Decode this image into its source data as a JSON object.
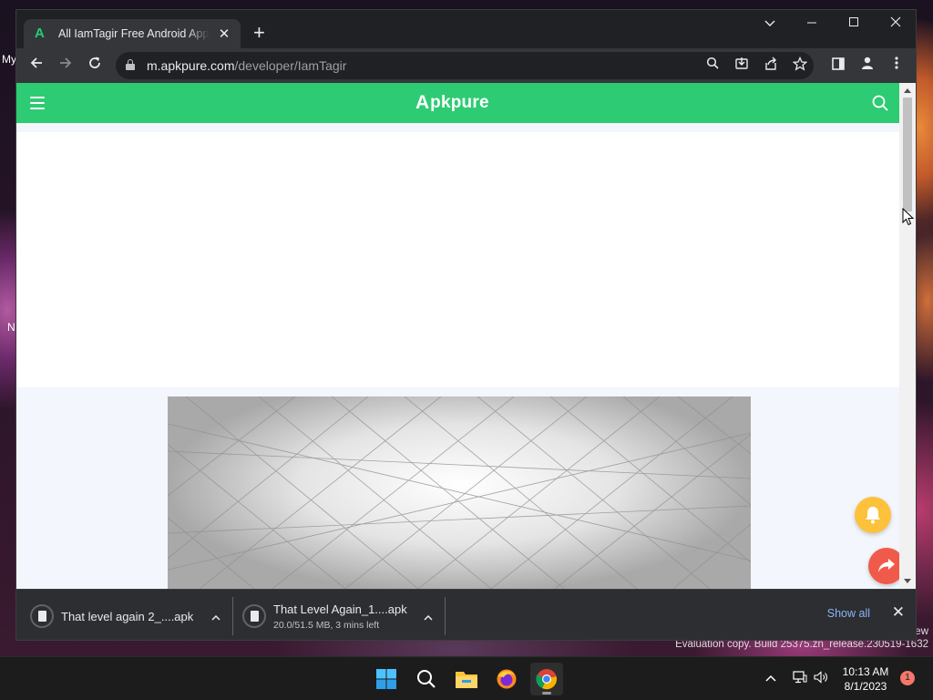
{
  "desktop": {
    "icon_labels": [
      "My",
      "N"
    ],
    "watermark_line1": "ew",
    "watermark_line2": "Evaluation copy. Build 25375.zn_release.230519-1632"
  },
  "browser": {
    "tab": {
      "title": "All IamTagir Free Android Apps & Games",
      "favicon": "apkpure-logo-icon",
      "close": "✕"
    },
    "new_tab": "+",
    "window_controls": {
      "dropdown": "⌵",
      "minimize": "—",
      "maximize": "☐",
      "close": "✕"
    },
    "nav": {
      "back": "←",
      "forward": "→",
      "reload": "↻"
    },
    "address": {
      "host": "m.apkpure.com",
      "path": "/developer/IamTagir"
    },
    "omnibox_icons": [
      "search-icon",
      "install-app-icon",
      "share-icon",
      "bookmark-star-icon"
    ],
    "toolbar_icons": [
      "side-panel-icon",
      "profile-icon",
      "menu-kebab-icon"
    ]
  },
  "page": {
    "header": {
      "logo_mark": "A",
      "logo_text": "pkpure",
      "brand_color": "#2dcb73"
    },
    "fab_colors": {
      "notification": "#fdc13b",
      "share": "#f05a4a"
    }
  },
  "downloads": {
    "items": [
      {
        "name": "That level again 2_....apk",
        "status": ""
      },
      {
        "name": "That Level Again_1....apk",
        "status": "20.0/51.5 MB, 3 mins left"
      }
    ],
    "show_all": "Show all",
    "close": "✕"
  },
  "taskbar": {
    "apps": [
      "windows-start-icon",
      "search-icon",
      "file-explorer-icon",
      "firefox-icon",
      "chrome-icon"
    ],
    "tray_chevron": "^",
    "time": "10:13 AM",
    "date": "8/1/2023",
    "notification_count": "1"
  }
}
